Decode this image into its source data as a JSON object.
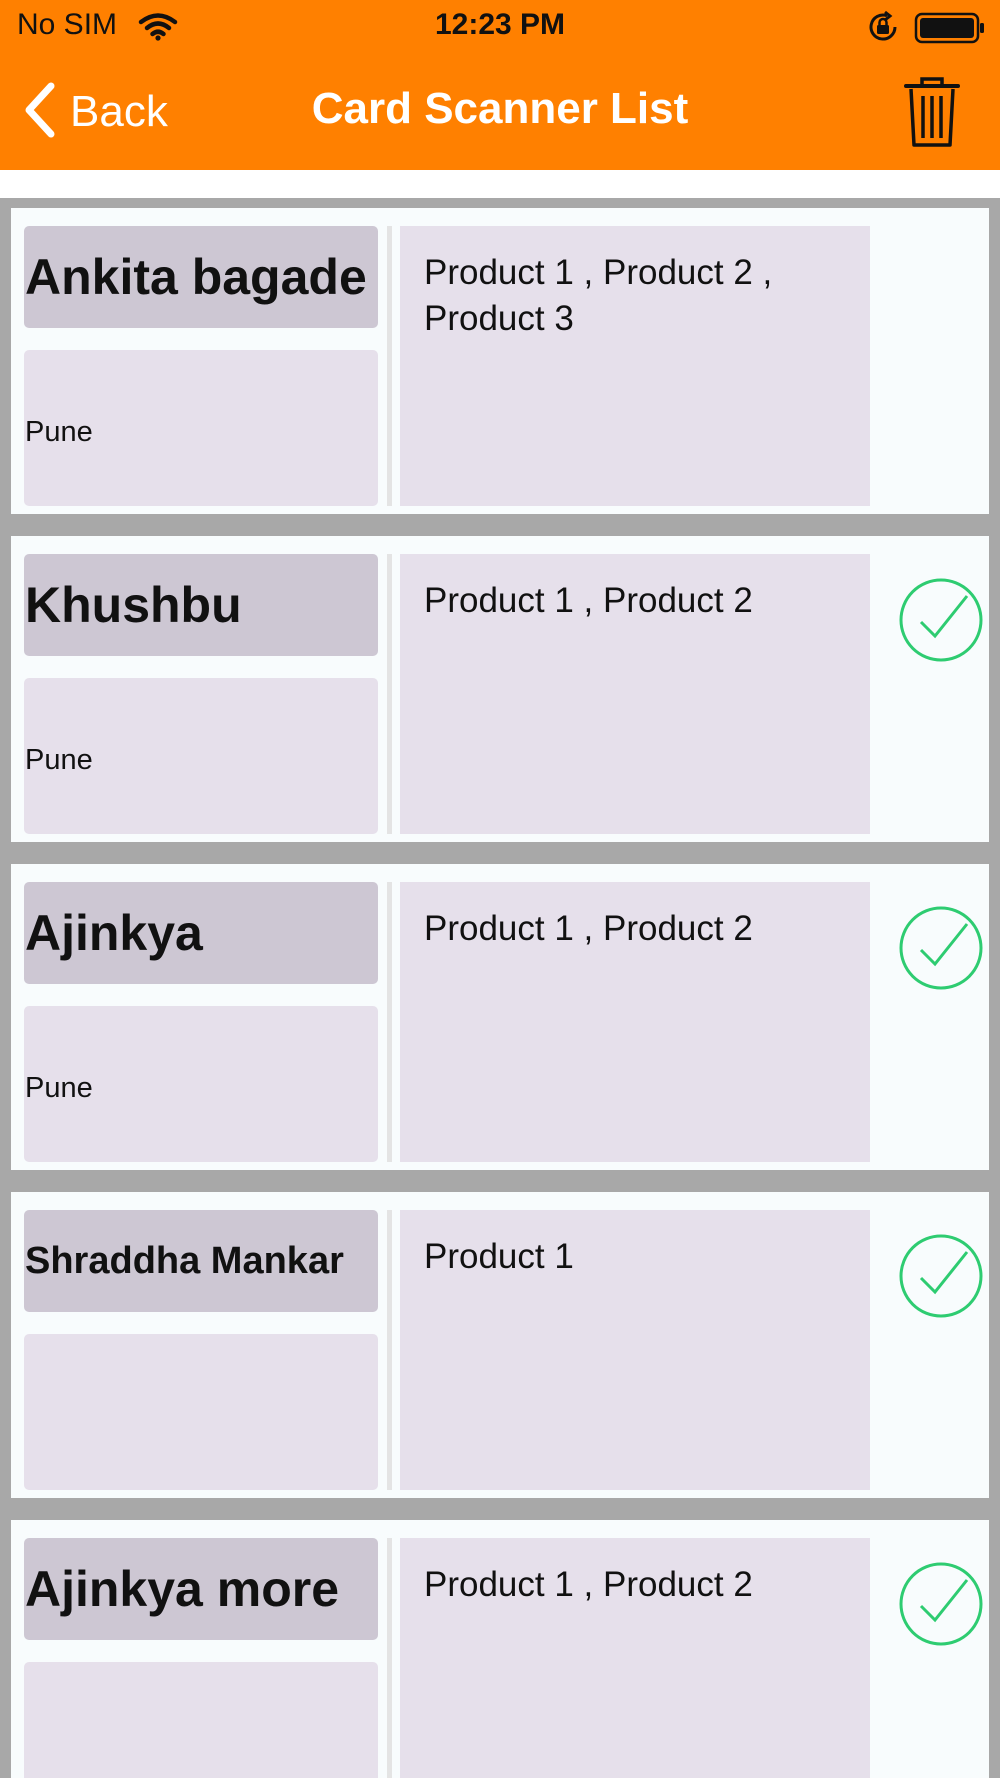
{
  "status_bar": {
    "carrier": "No SIM",
    "time": "12:23 PM"
  },
  "nav": {
    "back_label": "Back",
    "title": "Card Scanner List"
  },
  "colors": {
    "nav_background": "#ff8000",
    "name_background": "#cdc7d3",
    "field_background": "#e6e0eb",
    "check_green": "#2ecc71",
    "list_background": "#a8a8a8"
  },
  "cards": [
    {
      "name": "Ankita bagade",
      "city": "Pune",
      "products": "Product 1 , Product 2 , Product 3",
      "checked": false
    },
    {
      "name": "Khushbu",
      "city": "Pune",
      "products": "Product 1 , Product 2",
      "checked": true
    },
    {
      "name": "Ajinkya",
      "city": "Pune",
      "products": "Product 1 , Product 2",
      "checked": true
    },
    {
      "name": "Shraddha Mankar",
      "city": "",
      "products": "Product 1",
      "checked": true
    },
    {
      "name": "Ajinkya more",
      "city": "",
      "products": "Product 1 , Product 2",
      "checked": true
    }
  ]
}
